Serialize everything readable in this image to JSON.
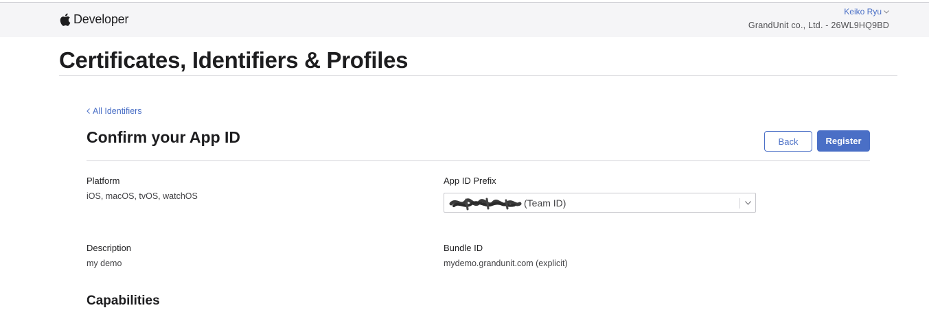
{
  "header": {
    "brand": "Developer",
    "user_name": "Keiko Ryu",
    "team": "GrandUnit co., Ltd. - 26WL9HQ9BD"
  },
  "page": {
    "title": "Certificates, Identifiers & Profiles"
  },
  "section": {
    "back_link": "All Identifiers",
    "title": "Confirm your App ID",
    "back_button": "Back",
    "register_button": "Register"
  },
  "fields": {
    "platform": {
      "label": "Platform",
      "value": "iOS, macOS, tvOS, watchOS"
    },
    "app_id_prefix": {
      "label": "App ID Prefix",
      "selected": "2██████9BD (Team ID)",
      "suffix": "(Team ID)"
    },
    "description": {
      "label": "Description",
      "value": "my demo"
    },
    "bundle_id": {
      "label": "Bundle ID",
      "value": "mydemo.grandunit.com (explicit)"
    }
  },
  "capabilities": {
    "title": "Capabilities"
  },
  "colors": {
    "accent": "#4a6fc6",
    "header_bg": "#f5f5f7",
    "rule": "#d2d2d7"
  },
  "icons": [
    "apple-logo-icon",
    "chevron-down-icon",
    "chevron-left-icon"
  ]
}
